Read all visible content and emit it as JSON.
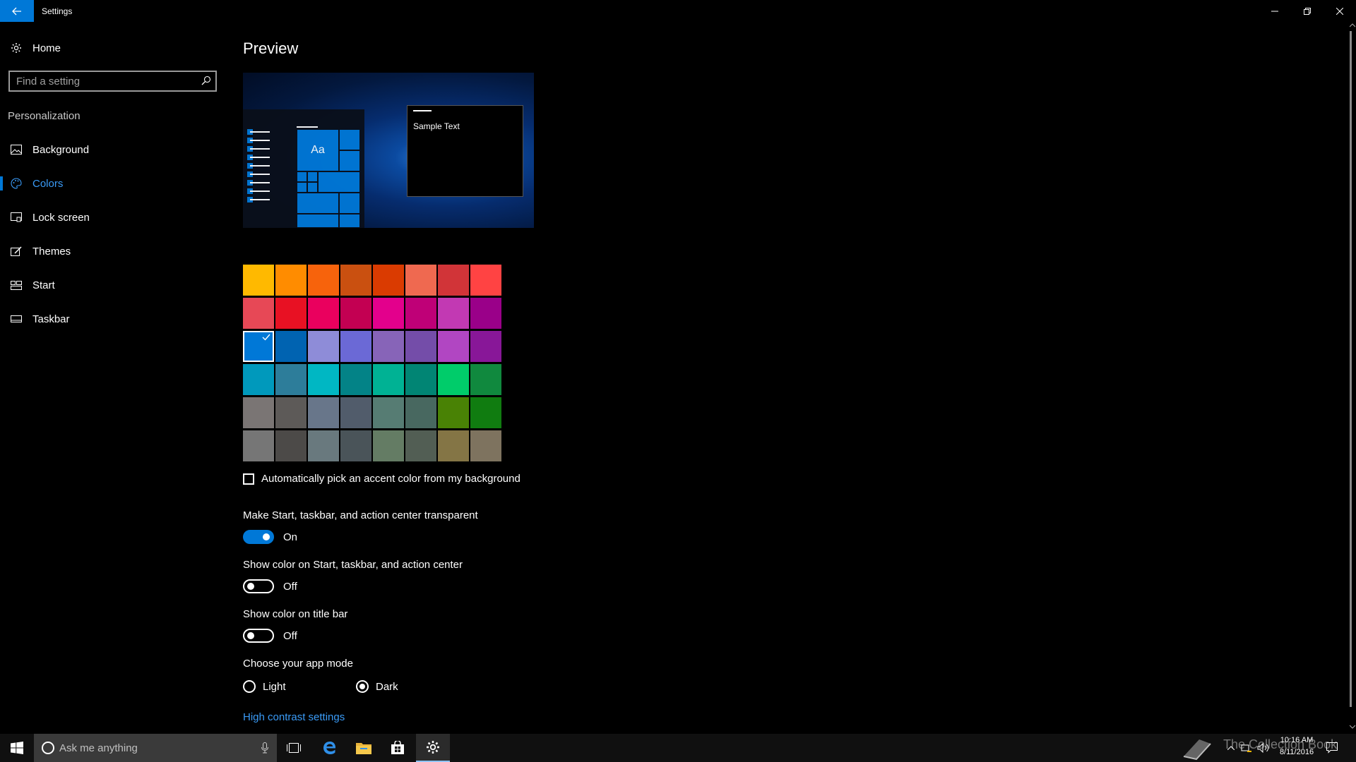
{
  "window": {
    "title": "Settings"
  },
  "sidebar": {
    "home_label": "Home",
    "search_placeholder": "Find a setting",
    "section_label": "Personalization",
    "items": [
      {
        "label": "Background",
        "icon": "image-icon"
      },
      {
        "label": "Colors",
        "icon": "palette-icon",
        "selected": true
      },
      {
        "label": "Lock screen",
        "icon": "lock-screen-icon"
      },
      {
        "label": "Themes",
        "icon": "themes-icon"
      },
      {
        "label": "Start",
        "icon": "start-icon"
      },
      {
        "label": "Taskbar",
        "icon": "taskbar-icon"
      }
    ]
  },
  "main": {
    "preview_title": "Preview",
    "preview_tile_text": "Aa",
    "preview_window_text": "Sample Text",
    "accent_colors": [
      [
        "#ffb900",
        "#ff8c00",
        "#f7630c",
        "#ca5010",
        "#da3b01",
        "#ef6950",
        "#d13438",
        "#ff4343"
      ],
      [
        "#e74856",
        "#e81123",
        "#ea005e",
        "#c30052",
        "#e3008c",
        "#bf0077",
        "#c239b3",
        "#9a0089"
      ],
      [
        "#0078d7",
        "#0063b1",
        "#8e8cd8",
        "#6b69d6",
        "#8764b8",
        "#744da9",
        "#b146c2",
        "#881798"
      ],
      [
        "#0099bc",
        "#2d7d9a",
        "#00b7c3",
        "#038387",
        "#00b294",
        "#018574",
        "#00cc6a",
        "#10893e"
      ],
      [
        "#7a7574",
        "#5d5a58",
        "#68768a",
        "#515c6b",
        "#567c73",
        "#486860",
        "#498205",
        "#107c10"
      ],
      [
        "#767676",
        "#4c4a48",
        "#69797e",
        "#4a5459",
        "#647c64",
        "#525e54",
        "#847545",
        "#7e735f"
      ]
    ],
    "selected_color": {
      "row": 2,
      "col": 0
    },
    "auto_pick_label": "Automatically pick an accent color from my background",
    "auto_pick_checked": false,
    "transparent": {
      "label": "Make Start, taskbar, and action center transparent",
      "state": "On"
    },
    "show_color_start": {
      "label": "Show color on Start, taskbar, and action center",
      "state": "Off"
    },
    "show_color_title": {
      "label": "Show color on title bar",
      "state": "Off"
    },
    "app_mode": {
      "label": "Choose your app mode",
      "options": [
        "Light",
        "Dark"
      ],
      "selected": "Dark"
    },
    "high_contrast_link": "High contrast settings"
  },
  "taskbar": {
    "search_placeholder": "Ask me anything",
    "time": "10:16 AM",
    "date": "8/11/2016"
  },
  "colors": {
    "accent": "#0078d7",
    "link": "#3a9bf7"
  }
}
